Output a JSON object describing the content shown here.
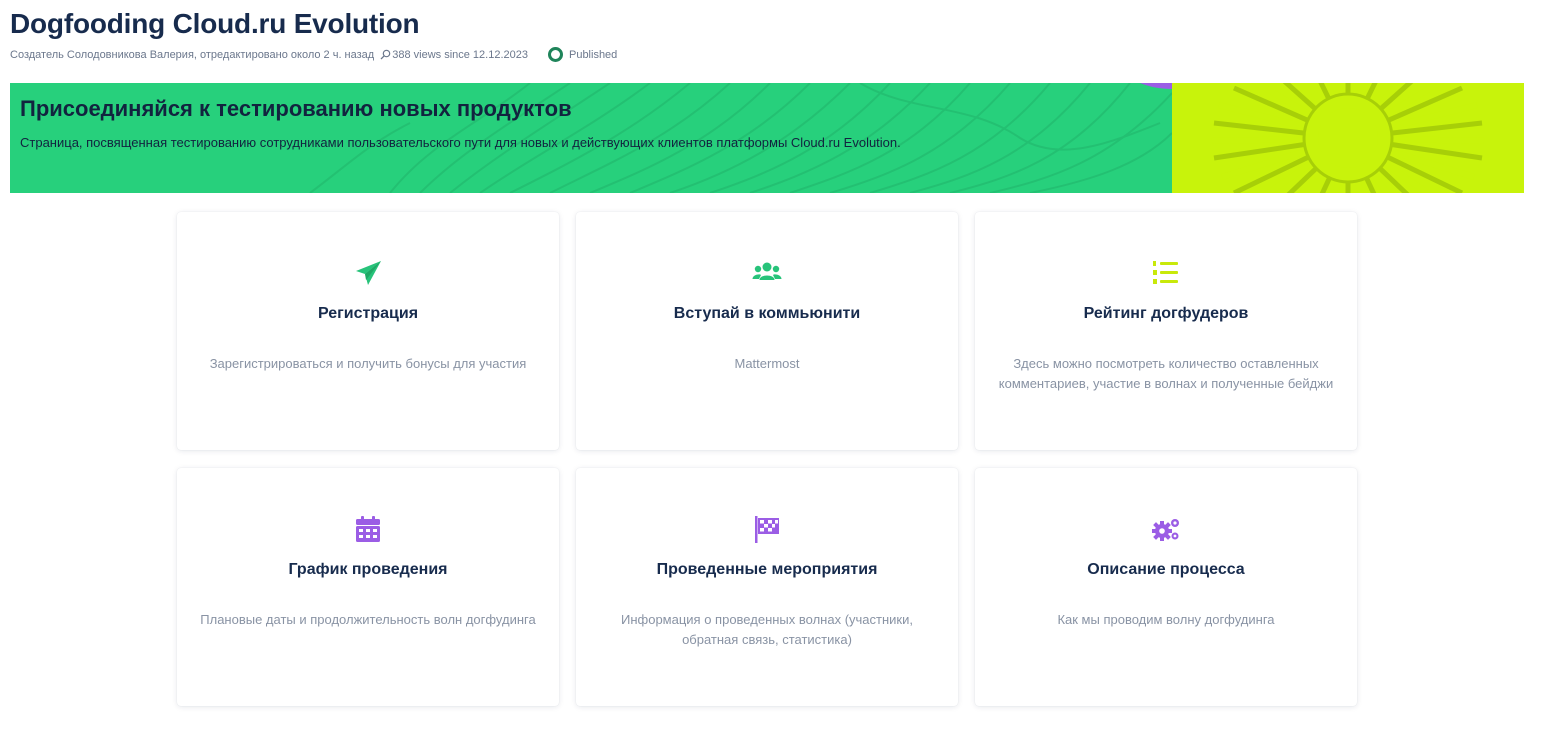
{
  "page": {
    "title": "Dogfooding Cloud.ru Evolution",
    "byline": "Создатель Солодовникова Валерия, отредактировано около 2 ч. назад",
    "views": "388 views since 12.12.2023",
    "status": "Published"
  },
  "banner": {
    "heading": "Присоединяйся к тестированию новых продуктов",
    "subtitle": "Страница, посвященная тестированию сотрудниками пользовательского пути для новых и действующих клиентов платформы Cloud.ru Evolution."
  },
  "colors": {
    "banner_green": "#27d07c",
    "banner_lime": "#c8f30b",
    "icon_green": "#27c37a",
    "icon_lime": "#c8e90a",
    "icon_purple": "#9b5de5",
    "status_green": "#1f845a"
  },
  "cards": [
    {
      "icon": "paper-plane-icon",
      "title": "Регистрация",
      "description": "Зарегистрироваться и получить бонусы для участия"
    },
    {
      "icon": "users-icon",
      "title": "Вступай в коммьюнити",
      "description": "Mattermost"
    },
    {
      "icon": "numbered-list-icon",
      "title": "Рейтинг догфудеров",
      "description": "Здесь можно посмотреть количество оставленных комментариев, участие в волнах и полученные бейджи"
    },
    {
      "icon": "calendar-icon",
      "title": "График проведения",
      "description": "Плановые даты и продолжительность волн догфудинга"
    },
    {
      "icon": "checkered-flag-icon",
      "title": "Проведенные мероприятия",
      "description": "Информация о проведенных волнах (участники, обратная связь, статистика)"
    },
    {
      "icon": "gears-icon",
      "title": "Описание процесса",
      "description": "Как мы проводим волну догфудинга"
    }
  ]
}
